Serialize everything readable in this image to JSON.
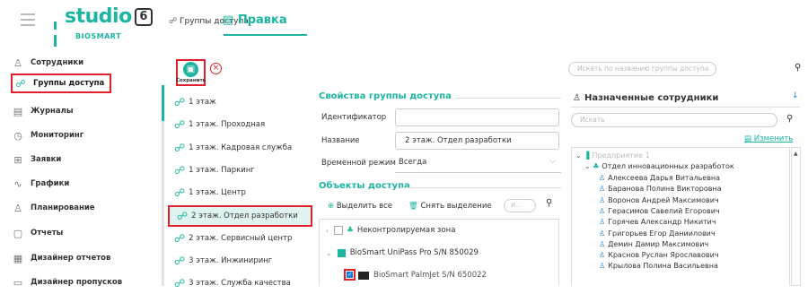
{
  "app": {
    "logo_text": "studio",
    "logo_version": "6",
    "logo_sub": "BIOSMART"
  },
  "header": {
    "tab_groups": "Группы доступа",
    "tab_edit": "Правка"
  },
  "sidebar": {
    "items": [
      {
        "label": "Сотрудники",
        "icon": "person-icon"
      },
      {
        "label": "Группы доступа",
        "icon": "group-icon",
        "active": true
      },
      {
        "label": "Журналы",
        "icon": "journal-icon"
      },
      {
        "label": "Мониторинг",
        "icon": "monitor-icon"
      },
      {
        "label": "Заявки",
        "icon": "request-icon"
      },
      {
        "label": "Графики",
        "icon": "schedule-icon"
      },
      {
        "label": "Планирование",
        "icon": "planning-icon"
      },
      {
        "label": "Отчеты",
        "icon": "report-icon"
      },
      {
        "label": "Дизайнер отчетов",
        "icon": "report-designer-icon"
      },
      {
        "label": "Дизайнер пропусков",
        "icon": "pass-designer-icon"
      }
    ]
  },
  "toolbar": {
    "save_label": "Сохранить"
  },
  "groups": [
    "1 этаж",
    "1 этаж. Проходная",
    "1 этаж. Кадровая служба",
    "1 этаж. Паркинг",
    "1 этаж. Центр",
    "2 этаж. Отдел разработки",
    "2 этаж. Сервисный центр",
    "3 этаж. Инжиниринг",
    "3 этаж. Служба качества"
  ],
  "selected_group_index": 5,
  "properties": {
    "title": "Свойства группы доступа",
    "id_label": "Идентификатор",
    "id_value": "",
    "name_label": "Название",
    "name_value": "2 этаж. Отдел разработки",
    "time_label": "Временной режим",
    "time_value": "Всегда"
  },
  "objects": {
    "title": "Объекты доступа",
    "select_all": "Выделить все",
    "deselect": "Снять выделение",
    "search_placeholder": "И...",
    "tree": [
      {
        "label": "Неконтролируемая зона",
        "level": 0,
        "checked": false
      },
      {
        "label": "BioSmart UniPass Pro S/N 850029",
        "level": 0,
        "expanded": true
      },
      {
        "label": "BioSmart PalmJet S/N 650022",
        "level": 1,
        "checked": true
      }
    ]
  },
  "right_panel": {
    "top_search_placeholder": "Искать по названию группы доступа",
    "assigned_title": "Назначенные сотрудники",
    "search_placeholder": "Искать",
    "edit_link": "Изменить",
    "enterprise": "Предприятие 1",
    "department": "Отдел инновационных разработок",
    "employees": [
      "Алексеева Дарья Витальевна",
      "Баранова Полина Викторовна",
      "Воронов Андрей Максимович",
      "Герасимов Савелий Егорович",
      "Горячев Александр Никитич",
      "Григорьев Егор Даниилович",
      "Демин Дамир Максимович",
      "Краснов Руслан Ярославович",
      "Крылова Полина Васильевна"
    ]
  }
}
